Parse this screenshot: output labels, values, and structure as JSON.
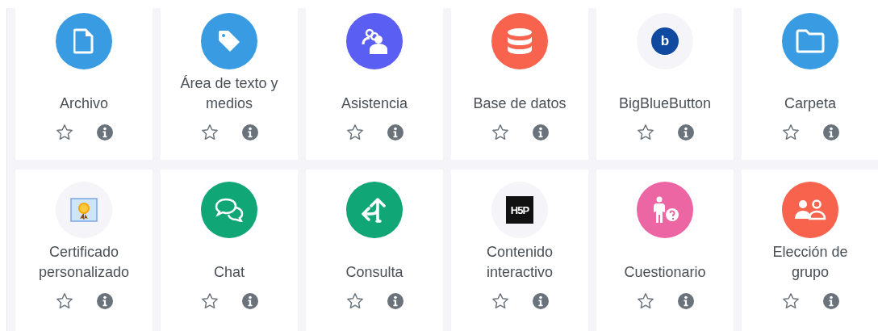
{
  "modules": [
    {
      "label": "Archivo",
      "kind": "file",
      "color": "#399be2",
      "starred": false
    },
    {
      "label": "Área de texto y medios",
      "kind": "tag",
      "color": "#399be2",
      "starred": false
    },
    {
      "label": "Asistencia",
      "kind": "people",
      "color": "#5b5ef2",
      "starred": false
    },
    {
      "label": "Base de datos",
      "kind": "database",
      "color": "#f7634d",
      "starred": false
    },
    {
      "label": "BigBlueButton",
      "kind": "logo",
      "color": "#f5f5f9",
      "logo_text": "b",
      "starred": false
    },
    {
      "label": "Carpeta",
      "kind": "folder",
      "color": "#399be2",
      "starred": false
    },
    {
      "label": "Certificado personalizado",
      "kind": "certificate",
      "color": "#f5f5f9",
      "starred": false
    },
    {
      "label": "Chat",
      "kind": "chat",
      "color": "#11a676",
      "starred": false
    },
    {
      "label": "Consulta",
      "kind": "split",
      "color": "#11a676",
      "starred": false
    },
    {
      "label": "Contenido interactivo",
      "kind": "h5p",
      "color": "#f5f5f9",
      "logo_text": "H5P",
      "starred": false
    },
    {
      "label": "Cuestionario",
      "kind": "quiz",
      "color": "#eb66a2",
      "starred": false
    },
    {
      "label": "Elección de grupo",
      "kind": "group",
      "color": "#f7634d",
      "starred": false
    }
  ]
}
